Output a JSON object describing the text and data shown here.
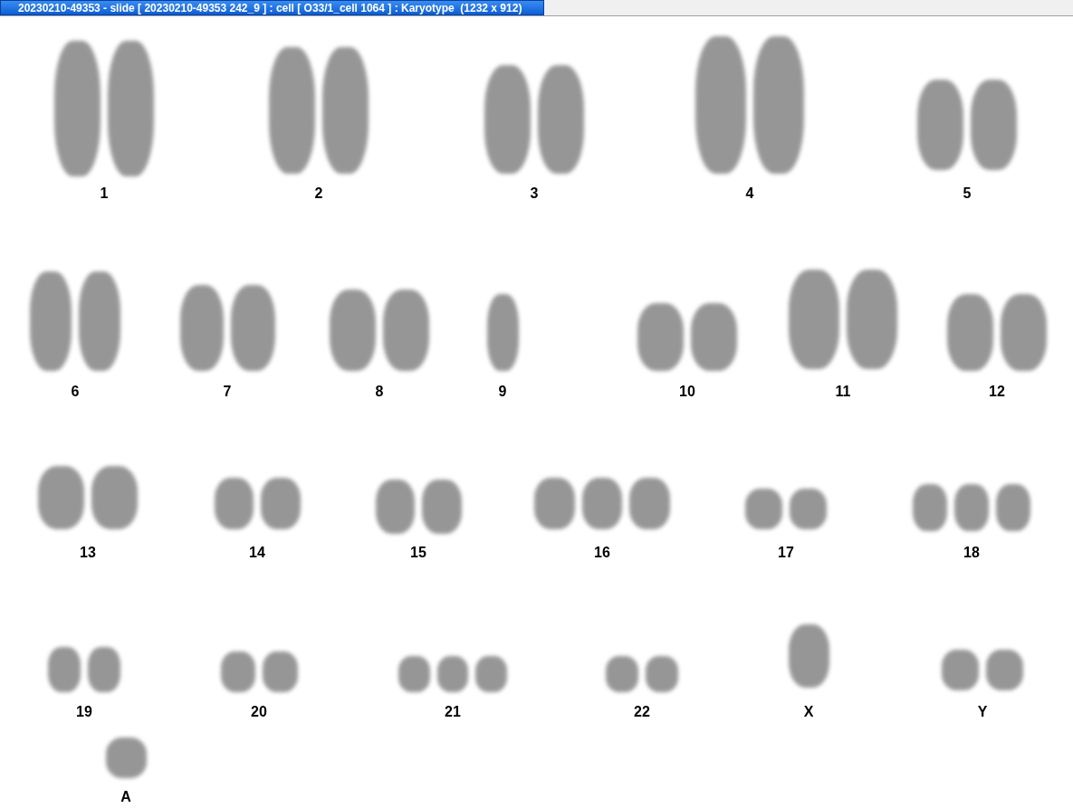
{
  "window": {
    "title": "20230210-49353 - slide [ 20230210-49353 242_9 ] : cell [ O33/1_cell 1064 ] : Karyotype  (1232 x 912)"
  },
  "karyotype": {
    "groups": [
      {
        "label": "1"
      },
      {
        "label": "2"
      },
      {
        "label": "3"
      },
      {
        "label": "4"
      },
      {
        "label": "5"
      },
      {
        "label": "6"
      },
      {
        "label": "7"
      },
      {
        "label": "8"
      },
      {
        "label": "9"
      },
      {
        "label": "10"
      },
      {
        "label": "11"
      },
      {
        "label": "12"
      },
      {
        "label": "13"
      },
      {
        "label": "14"
      },
      {
        "label": "15"
      },
      {
        "label": "16"
      },
      {
        "label": "17"
      },
      {
        "label": "18"
      },
      {
        "label": "19"
      },
      {
        "label": "20"
      },
      {
        "label": "21"
      },
      {
        "label": "22"
      },
      {
        "label": "X"
      },
      {
        "label": "Y"
      },
      {
        "label": "A"
      }
    ]
  }
}
